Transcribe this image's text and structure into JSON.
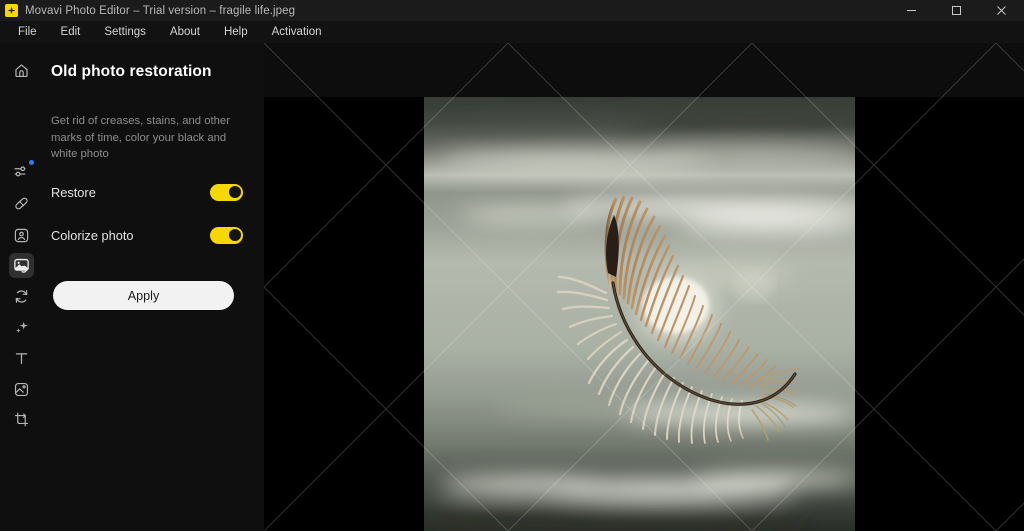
{
  "window": {
    "app_icon": "movavi-logo-icon",
    "title": "Movavi Photo Editor – Trial version – fragile life.jpeg",
    "controls": [
      {
        "name": "minimize",
        "glyph": "minimize-icon"
      },
      {
        "name": "maximize",
        "glyph": "maximize-icon"
      },
      {
        "name": "close",
        "glyph": "close-icon"
      }
    ]
  },
  "menubar": {
    "items": [
      {
        "label": "File"
      },
      {
        "label": "Edit"
      },
      {
        "label": "Settings"
      },
      {
        "label": "About"
      },
      {
        "label": "Help"
      },
      {
        "label": "Activation"
      }
    ]
  },
  "rail": {
    "items": [
      {
        "name": "home",
        "icon": "home-icon",
        "active": false,
        "badge": false
      },
      {
        "name": "adjust",
        "icon": "sliders-icon",
        "active": false,
        "badge": true
      },
      {
        "name": "retouch",
        "icon": "bandage-icon",
        "active": false,
        "badge": false
      },
      {
        "name": "object-removal",
        "icon": "portrait-frame-icon",
        "active": false,
        "badge": false
      },
      {
        "name": "old-photo-restoration",
        "icon": "photo-restore-icon",
        "active": true,
        "badge": false
      },
      {
        "name": "change-background",
        "icon": "refresh-circle-icon",
        "active": false,
        "badge": false
      },
      {
        "name": "effects",
        "icon": "sparkle-icon",
        "active": false,
        "badge": false
      },
      {
        "name": "text",
        "icon": "text-t-icon",
        "active": false,
        "badge": false
      },
      {
        "name": "frames",
        "icon": "frame-icon",
        "active": false,
        "badge": false
      },
      {
        "name": "crop",
        "icon": "crop-icon",
        "active": false,
        "badge": false
      }
    ]
  },
  "panel": {
    "title": "Old photo restoration",
    "description": "Get rid of creases, stains, and other marks of time, color your black and white photo",
    "toggles": [
      {
        "label": "Restore",
        "on": true
      },
      {
        "label": "Colorize photo",
        "on": true
      }
    ],
    "apply_label": "Apply"
  },
  "canvas": {
    "background_color": "#000000",
    "image_name": "fragile life.jpeg",
    "image_description": "A single brown and white feather floating above a softly blurred misty water landscape",
    "watermark": "trial-version-diagonal-cross-pattern"
  },
  "colors": {
    "accent": "#f5d800",
    "badge": "#2f7df6",
    "titlebar": "#1b1b1b",
    "panel": "#0f0f0f",
    "canvas": "#000000",
    "apply_button": "#f2f2f2"
  }
}
